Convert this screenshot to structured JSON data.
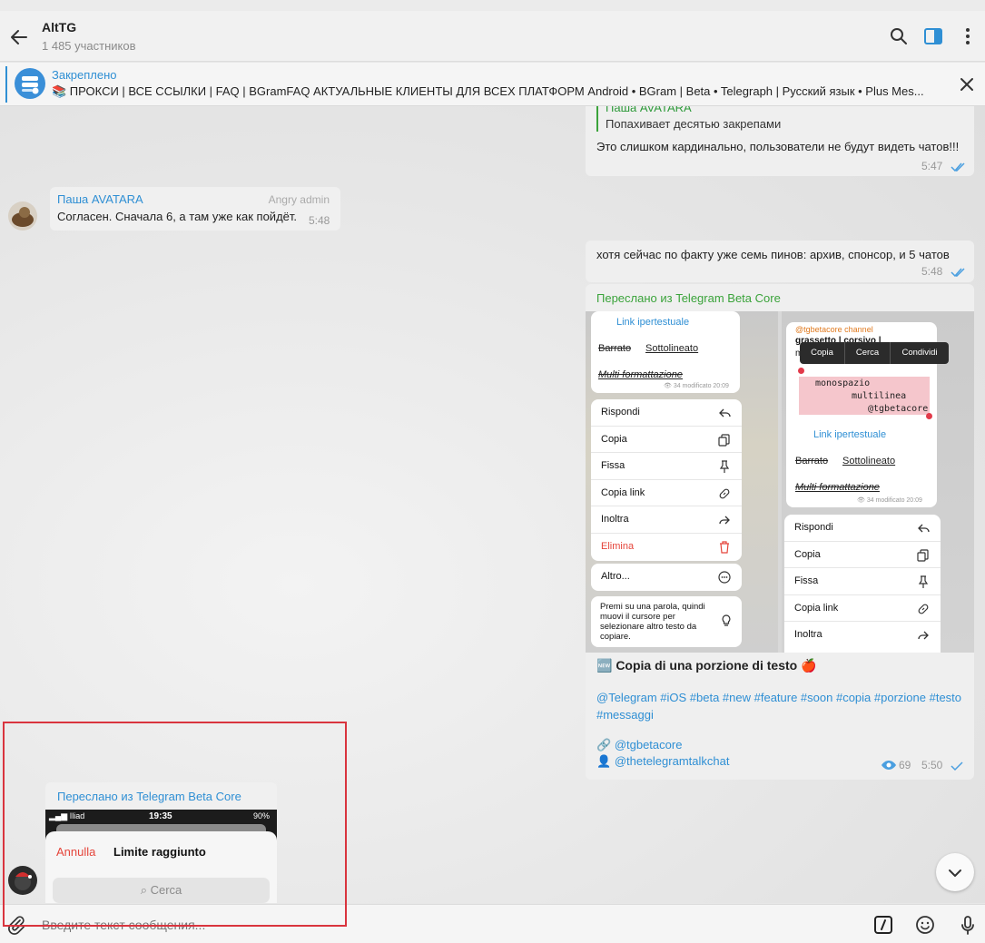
{
  "header": {
    "title": "AltTG",
    "subtitle": "1 485 участников"
  },
  "pinned": {
    "label": "Закреплено",
    "text": "📚 ПРОКСИ | ВСЕ ССЫЛКИ | FAQ | BGramFAQ  АКТУАЛЬНЫЕ КЛИЕНТЫ ДЛЯ ВСЕХ ПЛАТФОРМ  Android • BGram | Beta • Telegraph | Русский язык  • Plus Mes..."
  },
  "messages": {
    "m1": {
      "reply_name": "Паша AVATARA",
      "reply_text": "Попахивает десятью закрепами",
      "text": "Это слишком кардинально, пользователи не будут видеть чатов!!!",
      "time": "5:47"
    },
    "m2": {
      "name": "Паша AVATARA",
      "role": "Angry admin",
      "text": "Согласен. Сначала 6, а там уже как пойдёт.",
      "time": "5:48"
    },
    "m3": {
      "text": "хотя сейчас по факту уже семь пинов: архив, спонсор, и 5 чатов",
      "time": "5:48"
    },
    "m4": {
      "forwarded": "Переслано из Telegram Beta Core",
      "caption_title": "🆕 Copia di una porzione di testo 🍎",
      "hashtags": "@Telegram #iOS #beta #new #feature #soon #copia #porzione #testo #messaggi",
      "link1_prefix": "🔗",
      "link1": "@tgbetacore",
      "link2_prefix": "👤",
      "link2": "@thetelegramtalkchat",
      "views": "69",
      "time": "5:50",
      "shot_left": {
        "link": "Link ipertestuale",
        "barrato": "Barrato",
        "sottolineato": "Sottolineato",
        "multi": "Multi formattazione",
        "meta": "👁 34 modificato 20:09",
        "menu": [
          "Rispondi",
          "Copia",
          "Fissa",
          "Copia link",
          "Inoltra",
          "Elimina"
        ],
        "altro": "Altro...",
        "hint": "Premi su una parola, quindi muovi il cursore per selezionare altro testo da copiare."
      },
      "shot_right": {
        "channel": "@tgbetacore channel",
        "bold_line": "grassetto | corsivo |",
        "m_line": "m",
        "popup": [
          "Copia",
          "Cerca",
          "Condividi"
        ],
        "mono1": "monospazio",
        "mono2": "multilinea",
        "mono3": "@tgbetacore",
        "link": "Link ipertestuale",
        "barrato": "Barrato",
        "sottolineato": "Sottolineato",
        "multi": "Multi formattazione",
        "meta": "👁 34 modificato 20:09",
        "menu": [
          "Rispondi",
          "Copia",
          "Fissa",
          "Copia link",
          "Inoltra"
        ]
      }
    },
    "m5": {
      "forwarded": "Переслано из Telegram Beta Core",
      "status_carrier": "Iliad",
      "status_time": "19:35",
      "status_battery": "90%",
      "annulla": "Annulla",
      "title": "Limite raggiunto",
      "search": "Cerca"
    }
  },
  "composer": {
    "placeholder": "Введите текст сообщения..."
  },
  "colors": {
    "accent": "#2f8fd4",
    "forward_green": "#3aa33a",
    "highlight_red": "#d9343e"
  }
}
